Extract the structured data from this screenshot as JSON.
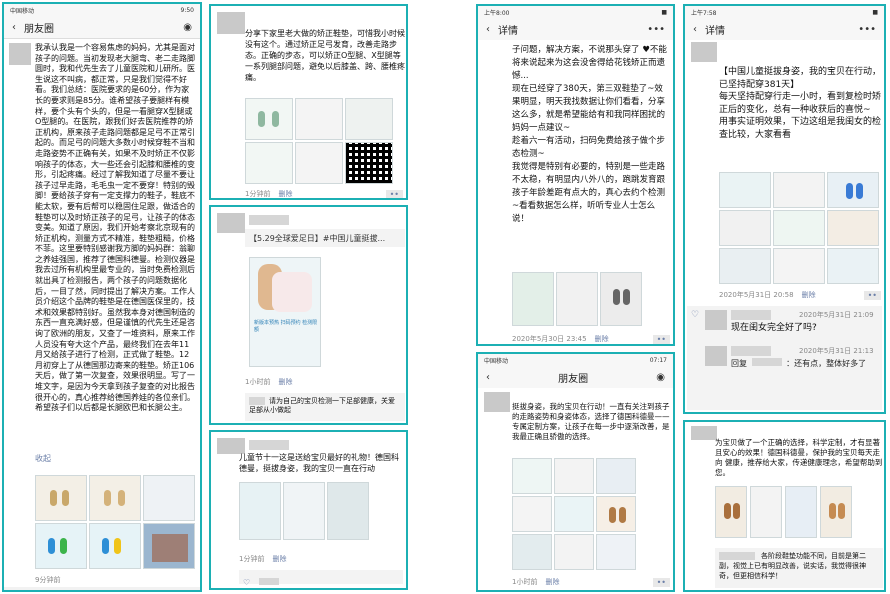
{
  "p1": {
    "status_left": "中国移动",
    "status_right": "9:50",
    "title": "朋友圈",
    "camera_icon": "camera-icon",
    "text": "我承认我是一个容易焦虑的妈妈，尤其是面对孩子的问题。当初发现老大腿弯、老二走路脚圆时，我和代先生去了儿童医院和儿研所。医生说这不叫病，都正常，只是我们觉得不好看。我们总结：医院要求的是60分，作为家长的要求则是85分。谁希望孩子要腿样有模样，要个头有个头的，但是一看腿穿X型腿或O型腿的。在医院，跟我们好去医院推荐的矫正机构，原来孩子走路问题都是足弓不正常引起的。而足弓的问题大多数小时候穿鞋不当和走路姿势不正确有关，如果不及时矫正不仅影响孩子的体态，大一些还会引起膝和腰椎的变形，引起疼痛。经过了解我知道了尽量不要让孩子过早走路，毛毛虫一定不要穿！特别的毁脚！要给孩子穿有一定支撑力的鞋子，鞋底不能太软，要有后帮可以稳固住足跟，做适合的鞋垫可以及时矫正孩子的足弓，让孩子的体态变美。知道了原因，我们开始考察北京现有的矫正机构，测量方式不精准，鞋垫粗糙，价格不菲。这里要特别感谢我方脚的妈妈群：翁聊之养娃强国，推荐了德国科德曼。检测仪器是我去过所有机构里最专业的，当时免费检测后就出具了检测报告，两个孩子的问题数据化后，一目了然，同时提出了解决方案。工作人员介绍这个品牌的鞋垫是在德国医保里的，技术和效果都特别好。虽然我本身对德国制造的东西一直充满好感，但是谨慎的代先生还是咨询了欧洲的朋友，又查了一堆资料，原来工作人员没有夸大这个产品，最终我们在去年11月又给孩子进行了检测，正式做了鞋垫。12月初穿上了从德国那边寄来的鞋垫。矫正106天后，做了第一次复查，效果很明显。写了一堆文字，是因为今天拿到孩子复查的对比报告很开心的，真心推荐给德国养娃的各位亲们。希望孩子们以后都是长腿欧巴和长腿公主。",
    "fold": "收起",
    "time": "9分钟前"
  },
  "p2": {
    "text": "分享下家里老大做的矫正鞋垫，可惜我小时候没有这个。通过矫正足弓发育，改善走路步态。正确的步态，可以矫正O型腿、X型腿等一系列腿部问题，避免以后膝盖、跨、腰椎疼痛。",
    "time": "1分钟前",
    "del": "删除",
    "more": "••"
  },
  "p3": {
    "link_title": "【5.29全球爱足日】#中国儿童挺拔...",
    "link_poster": "新版本预热 扫码预约 检测限额",
    "time": "1小时前",
    "del": "删除",
    "comment": "请为自己的宝贝检测一下足部健康，关爱足部从小做起"
  },
  "p4": {
    "text": "儿童节十一这是送给宝贝最好的礼物！德国科德曼，挺拔身姿，我的宝贝一直在行动",
    "time": "1分钟前",
    "del": "删除"
  },
  "p5": {
    "status_left": "上午8:00",
    "status_right": "■",
    "title": "详情",
    "text": "子问题，解决方案，不说那头穿了 ♥不能将来说起来为这会没舍得给花钱矫正而遗憾...\n现在已经穿了380天，第三双鞋垫了~效果明显，明天我找数据让你们看看，分享这么多，就是希望能给有和我同样困扰的妈妈一点建议~\n趁着六一有活动，扫码免费给孩子做个步态检测~\n我觉得是特别有必要的，特别是一些走路不太稳，有明显内八外八的，跑跳发育跟孩子年龄差距有点大的，真心去约个检测~看看数据怎么样，听听专业人士怎么说！",
    "time": "2020年5月30日 23:45",
    "del": "删除"
  },
  "p6": {
    "status_left": "中国移动",
    "status_right": "07:17",
    "title": "朋友圈",
    "text": "挺拔身姿，我的宝贝在行动！一直有关注到孩子的走路姿势和身姿体态，选择了德国科德曼——专属定制方案，让孩子在每一步中逐渐改善，是我最正确且骄傲的选择。",
    "time": "1小时前",
    "del": "删除"
  },
  "p7": {
    "status_left": "上午7:58",
    "status_right": "■",
    "title": "详情",
    "text": "【中国儿童挺拔身姿，我的宝贝在行动，已坚持配穿381天】\n每天坚持配穿行走一小时，看到复检时矫正后的变化，总有一种收获后的喜悦~\n用事实证明效果，下边这组是我闺女的检查比较，大家看看",
    "time": "2020年5月31日 20:58",
    "del": "删除",
    "c1_time": "2020年5月31日 21:09",
    "c1_text": "现在闺女完全好了吗?",
    "c2_time": "2020年5月31日 21:13",
    "c2_prefix": "回复",
    "c2_text": "：还有点，整体好多了"
  },
  "p8": {
    "text": "为宝贝做了一个正确的选择，科学定制，才有显著且安心的效果！德国科德曼，保护我的宝贝每天走向 健康，推荐给大家，传递健康理念，希望帮助到您。",
    "comment": "各阶段鞋垫功能不同，目前是第二副，视觉上已有明显改善，说实话，我觉得很神奇，但更相信科学！"
  }
}
